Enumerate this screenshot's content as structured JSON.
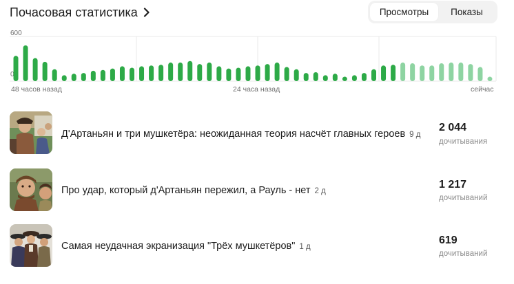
{
  "header": {
    "title": "Почасовая статистика",
    "chevron_icon": "chevron-right-icon"
  },
  "toggle": {
    "views_label": "Просмотры",
    "impressions_label": "Показы",
    "active": "Просмотры"
  },
  "chart_data": {
    "type": "bar",
    "y_max_label": "600",
    "y_min_label": "0",
    "ylim": [
      0,
      600
    ],
    "x_labels": [
      "48 часов назад",
      "24 часа назад",
      "сейчас"
    ],
    "grid": true,
    "colors": {
      "past": "#2daa47",
      "recent": "#8ed4a2"
    },
    "values": [
      340,
      480,
      310,
      260,
      160,
      80,
      100,
      110,
      140,
      150,
      170,
      200,
      180,
      200,
      210,
      220,
      250,
      250,
      270,
      230,
      250,
      200,
      170,
      180,
      200,
      210,
      230,
      250,
      190,
      160,
      110,
      120,
      80,
      100,
      60,
      80,
      110,
      160,
      210,
      220,
      250,
      240,
      210,
      210,
      240,
      250,
      250,
      230,
      190,
      60
    ],
    "recent_from_index": 40
  },
  "articles": [
    {
      "title": "Д'Артаньян и три мушкетёра: неожиданная теория насчёт главных героев",
      "age": "9 д",
      "count": "2 044",
      "count_label": "дочитывания"
    },
    {
      "title": "Про удар, который д'Артаньян пережил, а Рауль - нет",
      "age": "2 д",
      "count": "1 217",
      "count_label": "дочитываний"
    },
    {
      "title": "Самая неудачная экранизация \"Трёх мушкетёров\"",
      "age": "1 д",
      "count": "619",
      "count_label": "дочитываний"
    }
  ]
}
